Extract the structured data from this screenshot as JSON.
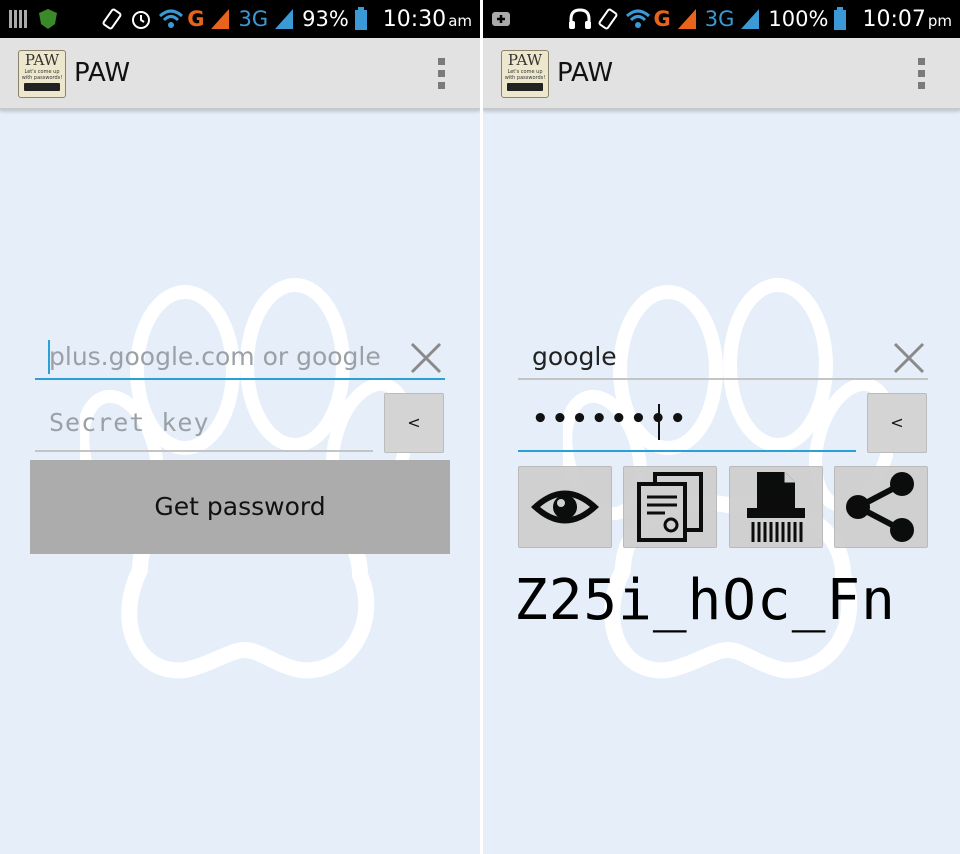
{
  "accent_color": "#2aa0d6",
  "screens": [
    {
      "status_bar": {
        "icons": [
          "notification-bars-icon",
          "shield-icon",
          "rotate-icon",
          "alarm-icon",
          "wifi-icon",
          "signal-g-icon",
          "signal-3g-icon",
          "battery-icon"
        ],
        "network_g": "G",
        "network_3g": "3G",
        "battery": "93%",
        "time": "10:30",
        "ampm": "am"
      },
      "action_bar": {
        "logo_title": "PAW",
        "logo_subtitle": "Let's come up with passwords!",
        "title": "PAW",
        "menu_icon": "overflow-menu-icon"
      },
      "site_field": {
        "value": "",
        "placeholder": "plus.google.com or google"
      },
      "key_field": {
        "value": "",
        "placeholder": "Secret key"
      },
      "backspace_label": "<",
      "get_password_label": "Get password"
    },
    {
      "status_bar": {
        "icons": [
          "add-notification-icon",
          "headphones-icon",
          "rotate-icon",
          "wifi-icon",
          "signal-g-icon",
          "signal-3g-icon",
          "battery-icon"
        ],
        "network_g": "G",
        "network_3g": "3G",
        "battery": "100%",
        "time": "10:07",
        "ampm": "pm"
      },
      "action_bar": {
        "logo_title": "PAW",
        "logo_subtitle": "Let's come up with passwords!",
        "title": "PAW",
        "menu_icon": "overflow-menu-icon"
      },
      "site_field": {
        "value": "google",
        "placeholder": ""
      },
      "key_field": {
        "value": "••••••••",
        "placeholder": ""
      },
      "backspace_label": "<",
      "action_icons": [
        "eye-icon",
        "copy-icon",
        "shredder-icon",
        "share-icon"
      ],
      "generated_password": "Z25i_hOc_Fn"
    }
  ]
}
